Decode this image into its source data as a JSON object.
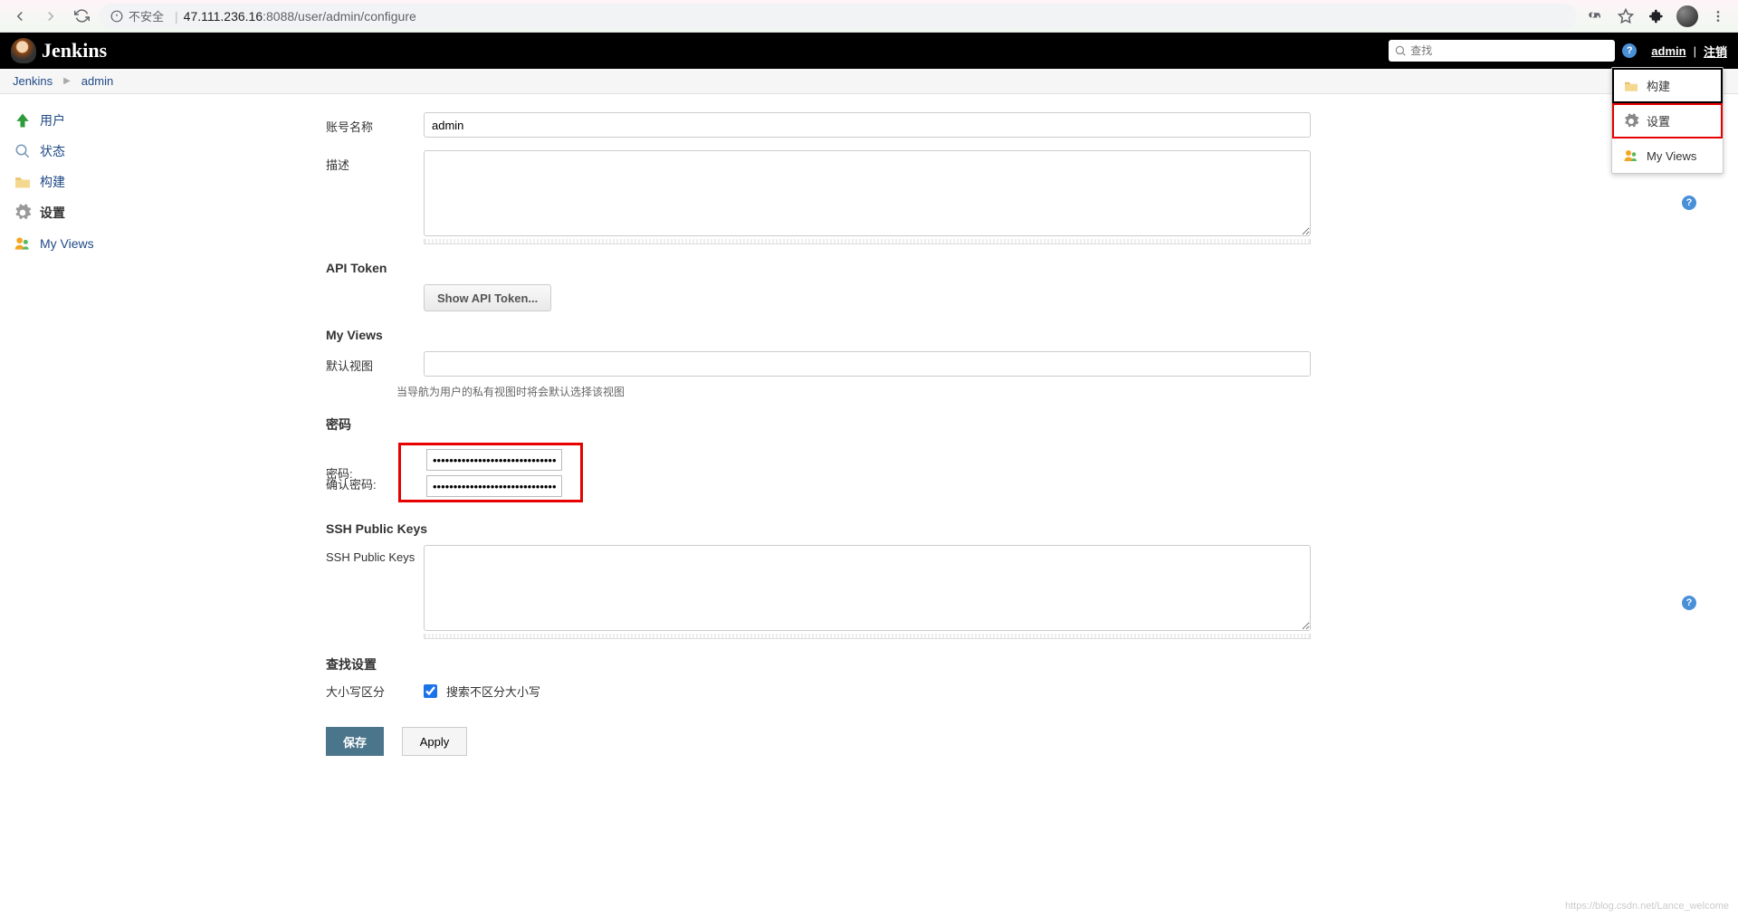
{
  "browser": {
    "insecure_label": "不安全",
    "url_host": "47.111.236.16",
    "url_port": ":8088",
    "url_path": "/user/admin/configure"
  },
  "header": {
    "product": "Jenkins",
    "search_placeholder": "查找",
    "user": "admin",
    "logout": "注销"
  },
  "breadcrumb": {
    "home": "Jenkins",
    "user": "admin"
  },
  "sidebar": {
    "items": [
      {
        "label": "用户"
      },
      {
        "label": "状态"
      },
      {
        "label": "构建"
      },
      {
        "label": "设置"
      },
      {
        "label": "My Views"
      }
    ]
  },
  "dropdown": {
    "build": "构建",
    "configure": "设置",
    "my_views": "My Views"
  },
  "form": {
    "name_label": "账号名称",
    "name_value": "admin",
    "desc_label": "描述",
    "desc_value": "",
    "api_token_heading": "API Token",
    "show_api_token_btn": "Show API Token...",
    "my_views_heading": "My Views",
    "default_view_label": "默认视图",
    "default_view_value": "",
    "default_view_hint": "当导航为用户的私有视图时将会默认选择该视图",
    "password_heading": "密码",
    "password_label": "密码:",
    "password_value": "••••••••••••••••••••••••••••••",
    "confirm_label": "确认密码:",
    "confirm_value": "••••••••••••••••••••••••••••••",
    "ssh_heading": "SSH Public Keys",
    "ssh_label": "SSH Public Keys",
    "ssh_value": "",
    "search_heading": "查找设置",
    "case_label": "大小写区分",
    "case_checkbox_label": "搜索不区分大小写",
    "case_checked": true,
    "save_btn": "保存",
    "apply_btn": "Apply"
  },
  "watermark": "https://blog.csdn.net/Lance_welcome"
}
